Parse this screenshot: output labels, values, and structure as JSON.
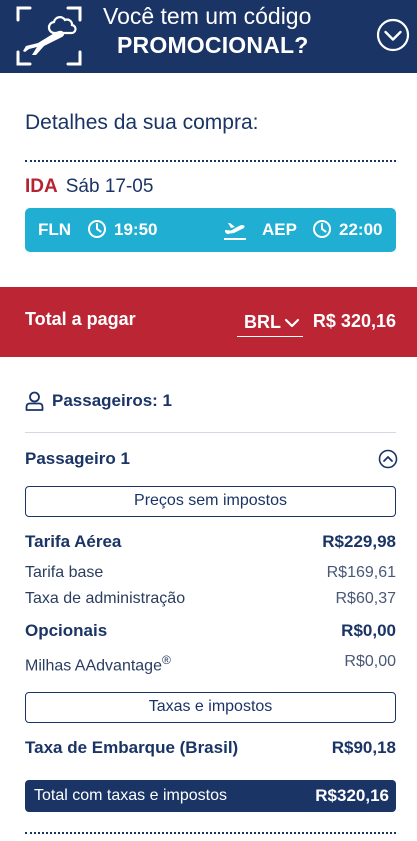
{
  "promo": {
    "line1": "Você tem um código",
    "line2": "PROMOCIONAL?",
    "icon": "ticket-plane-icon",
    "toggle_icon": "chevron-down-circle-icon"
  },
  "details": {
    "title": "Detalhes da sua compra:",
    "leg_label": "IDA",
    "leg_date": "Sáb 17-05",
    "origin": "FLN",
    "departure_time": "19:50",
    "destination": "AEP",
    "arrival_time": "22:00"
  },
  "total": {
    "label": "Total a pagar",
    "currency": "BRL",
    "amount": "R$ 320,16"
  },
  "passengers": {
    "count_label": "Passageiros: 1",
    "passenger_label": "Passageiro 1",
    "prices_no_tax_button": "Preços sem impostos",
    "taxes_button": "Taxas e impostos",
    "rows": [
      {
        "label": "Tarifa Aérea",
        "value": "R$229,98"
      },
      {
        "label": "Tarifa base",
        "value": "R$169,61"
      },
      {
        "label": "Taxa de administração",
        "value": "R$60,37"
      },
      {
        "label": "Opcionais",
        "value": "R$0,00"
      },
      {
        "label": "Milhas AAdvantage",
        "sup": "®",
        "value": "R$0,00"
      },
      {
        "label": "Taxa de Embarque (Brasil)",
        "value": "R$90,18"
      }
    ],
    "grand_total_label": "Total com taxas e impostos",
    "grand_total_value": "R$320,16"
  },
  "colors": {
    "navy": "#1b3466",
    "red": "#bb2534",
    "cyan": "#21aed3",
    "ida_red": "#b52430"
  }
}
